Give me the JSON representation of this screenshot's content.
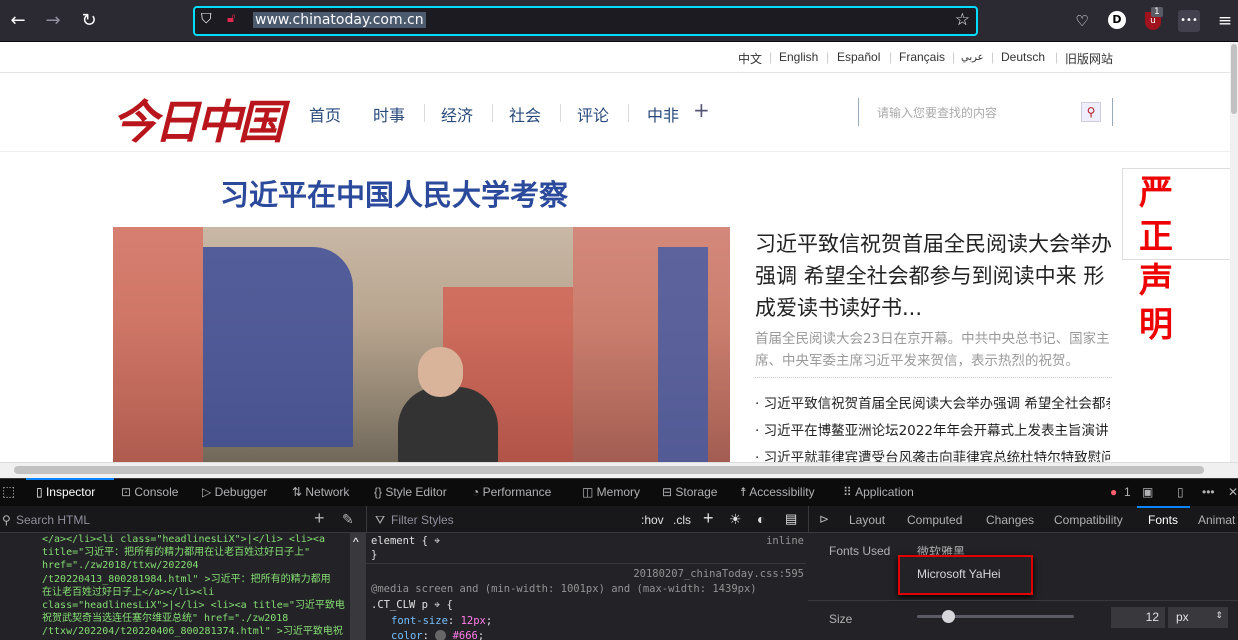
{
  "browser": {
    "url": "www.chinatoday.com.cn",
    "extension_badge": "1",
    "account_initial": "D"
  },
  "site": {
    "languages": [
      "中文",
      "English",
      "Español",
      "Français",
      "عربي",
      "Deutsch",
      "旧版网站"
    ],
    "logo": "今日中国",
    "nav": [
      "首页",
      "时事",
      "经济",
      "社会",
      "评论",
      "中非"
    ],
    "nav_more": "+",
    "search_placeholder": "请输入您要查找的内容",
    "headline": "习近平在中国人民大学考察",
    "notice": "严正声明",
    "main_story_title": "习近平致信祝贺首届全民阅读大会举办强调 希望全社会都参与到阅读中来 形成爱读书读好书...",
    "main_story_summary": "首届全民阅读大会23日在京开幕。中共中央总书记、国家主席、中央军委主席习近平发来贺信，表示热烈的祝贺。",
    "list": [
      "习近平致信祝贺首届全民阅读大会举办强调 希望全社会都参与到阅读中来",
      "习近平在博鳌亚洲论坛2022年年会开幕式上发表主旨演讲",
      "习近平就菲律宾遭受台风袭击向菲律宾总统杜特尔特致慰问电"
    ]
  },
  "devtools": {
    "tabs": [
      "Inspector",
      "Console",
      "Debugger",
      "Network",
      "Style Editor",
      "Performance",
      "Memory",
      "Storage",
      "Accessibility",
      "Application"
    ],
    "error_count": "1",
    "search_html_placeholder": "Search HTML",
    "markup_lines": [
      "</a></li><li class=\"headlinesLiX\">|</li> <li><a",
      "title=\"习近平：把所有的精力都用在让老百姓过好日子上\"",
      "href=\"./zw2018/ttxw/202204",
      "/t20220413_800281984.html\" >习近平：把所有的精力都用",
      "在让老百姓过好日子上</a></li><li",
      "class=\"headlinesLiX\">|</li> <li><a title=\"习近平致电",
      "祝贺武契奇当选连任塞尔维亚总统\" href=\"./zw2018",
      "/ttxw/202204/t20220406_800281374.html\" >习近平致电祝"
    ],
    "filter_styles_placeholder": "Filter Styles",
    "hov": ":hov",
    "cls": ".cls",
    "rules": {
      "element": "element {",
      "close": "}",
      "inline": "inline",
      "source": "20180207_chinaToday.css:595",
      "media": "@media screen and (min-width: 1001px) and (max-width: 1439px)",
      "selector": ".CT_CLW p",
      "prop1": "font-size",
      "val1": "12px",
      "prop2": "color",
      "val2": "#666"
    },
    "side_tabs": [
      "Layout",
      "Computed",
      "Changes",
      "Compatibility",
      "Fonts",
      "Animat"
    ],
    "fonts": {
      "label": "Fonts Used",
      "font_name": "微软雅黑",
      "font_tooltip": "Microsoft YaHei",
      "size_label": "Size",
      "size_value": "12",
      "size_unit": "px",
      "size_fraction": 0.2
    },
    "colors": {
      "accent": "#0a84ff",
      "highlight_box": "#e00000",
      "site_blue": "#2c4a9c",
      "logo_red": "#b8161c"
    }
  }
}
